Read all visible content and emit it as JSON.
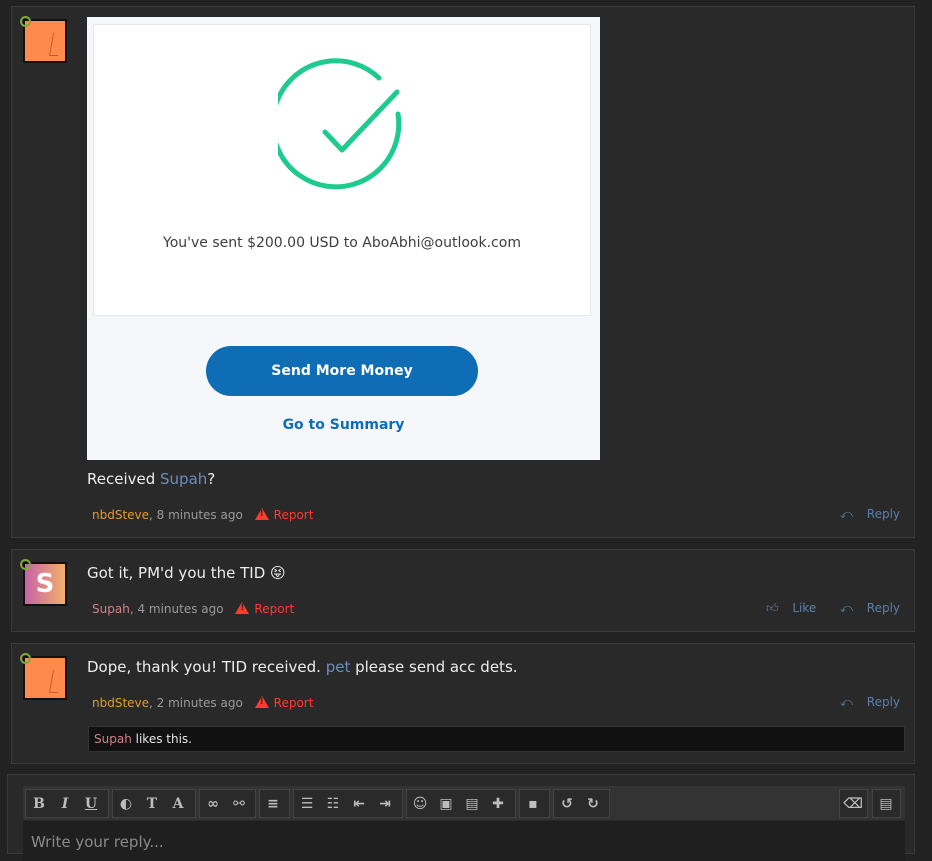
{
  "posts": [
    {
      "paypal": {
        "message": "You've sent $200.00 USD to AboAbhi@outlook.com",
        "send_button": "Send More Money",
        "summary_link": "Go to Summary",
        "check_color": "#1ecb8e"
      },
      "message_prefix": "Received ",
      "message_mention": "Supah",
      "message_suffix": "?",
      "author": "nbdSteve",
      "time": ", 8 minutes ago",
      "report": "Report",
      "reply": "Reply"
    },
    {
      "avatar_letter": "S",
      "message": "Got it, PM'd you the TID 😝",
      "author": "Supah",
      "time": ", 4 minutes ago",
      "report": "Report",
      "like": "Like",
      "reply": "Reply"
    },
    {
      "message_prefix": "Dope, thank you! TID received. ",
      "message_mention": "pet",
      "message_suffix": " please send acc dets.",
      "author": "nbdSteve",
      "time": ", 2 minutes ago",
      "report": "Report",
      "reply": "Reply",
      "likes_user": "Supah",
      "likes_text": " likes this."
    }
  ],
  "editor": {
    "placeholder": "Write your reply...",
    "toolbar_icons": [
      "bold-icon",
      "italic-icon",
      "underline-icon",
      "color-icon",
      "font-size-icon",
      "font-family-icon",
      "link-icon",
      "unlink-icon",
      "align-icon",
      "bullet-list-icon",
      "numbered-list-icon",
      "outdent-icon",
      "indent-icon",
      "smiley-icon",
      "image-icon",
      "media-icon",
      "insert-icon",
      "save-icon",
      "undo-icon",
      "redo-icon",
      "eraser-icon",
      "preview-icon"
    ]
  },
  "colors": {
    "page_bg": "#222222",
    "post_bg": "#292929",
    "mention": "#6c8ebf",
    "author_orange": "#e39a2c",
    "author_pink": "#d77f86",
    "report": "#ff3b30",
    "paypal_blue": "#0f6db6"
  }
}
